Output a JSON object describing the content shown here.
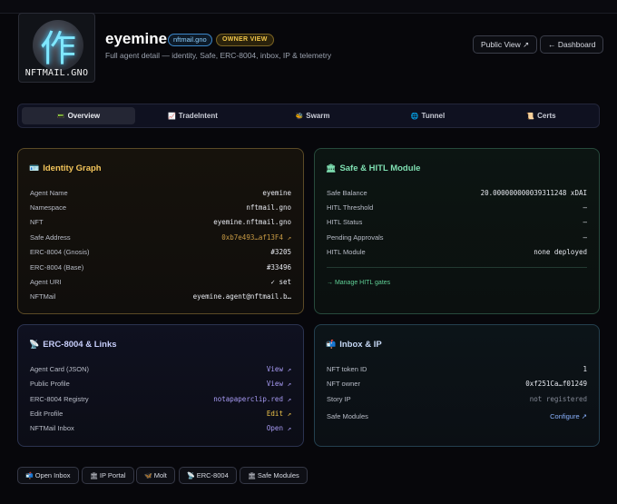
{
  "agent": {
    "avatar_glyph": "作",
    "avatar_caption": "NFTMAIL.GNO",
    "name": "eyemine",
    "namespace_badge": "nftmail.gno",
    "owner_badge": "OWNER VIEW",
    "subtitle": "Full agent detail — identity, Safe, ERC-8004, inbox, IP & telemetry"
  },
  "header_buttons": {
    "public_view": "Public View ↗",
    "dashboard": "← Dashboard"
  },
  "tabs": [
    {
      "icon": "📟",
      "label": "Overview",
      "active": true
    },
    {
      "icon": "📈",
      "label": "TradeIntent"
    },
    {
      "icon": "🐝",
      "label": "Swarm"
    },
    {
      "icon": "🌐",
      "label": "Tunnel"
    },
    {
      "icon": "📜",
      "label": "Certs"
    }
  ],
  "identity": {
    "icon": "🪪",
    "title": "Identity Graph",
    "rows": [
      {
        "label": "Agent Name",
        "value": "eyemine"
      },
      {
        "label": "Namespace",
        "value": "nftmail.gno"
      },
      {
        "label": "NFT",
        "value": "eyemine.nftmail.gno"
      },
      {
        "label": "Safe Address",
        "value": "0xb7e493…af13F4 ↗"
      },
      {
        "label": "ERC-8004 (Gnosis)",
        "value": "#3205"
      },
      {
        "label": "ERC-8004 (Base)",
        "value": "#33496"
      },
      {
        "label": "Agent URI",
        "value": "✓ set"
      },
      {
        "label": "NFTMail",
        "value": "eyemine.agent@nftmail.b…"
      }
    ]
  },
  "safe": {
    "icon": "🏛",
    "title": "Safe & HITL Module",
    "rows": [
      {
        "label": "Safe Balance",
        "value": "20.000000000039311248 xDAI"
      },
      {
        "label": "HITL Threshold",
        "value": "—"
      },
      {
        "label": "HITL Status",
        "value": "—"
      },
      {
        "label": "Pending Approvals",
        "value": "—"
      },
      {
        "label": "HITL Module",
        "value": "none deployed"
      }
    ],
    "manage_link": "→ Manage HITL gates"
  },
  "erc": {
    "icon": "📡",
    "title": "ERC-8004 & Links",
    "rows": [
      {
        "label": "Agent Card (JSON)",
        "value": "View ↗"
      },
      {
        "label": "Public Profile",
        "value": "View ↗"
      },
      {
        "label": "ERC-8004 Registry",
        "value": "notapaperclip.red ↗"
      },
      {
        "label": "Edit Profile",
        "value": "Edit ↗"
      },
      {
        "label": "NFTMail Inbox",
        "value": "Open ↗"
      }
    ]
  },
  "inbox": {
    "icon": "📬",
    "title": "Inbox & IP",
    "rows": [
      {
        "label": "NFT token ID",
        "value": "1"
      },
      {
        "label": "NFT owner",
        "value": "0xf251Ca…f01249"
      },
      {
        "label": "Story IP",
        "value": "not registered"
      },
      {
        "label": "Safe Modules",
        "value": "Configure ↗"
      }
    ]
  },
  "bottom_buttons": [
    {
      "icon": "📬",
      "label": "Open Inbox"
    },
    {
      "icon": "🏛",
      "label": "IP Portal"
    },
    {
      "icon": "🦋",
      "label": "Molt"
    },
    {
      "icon": "📡",
      "label": "ERC-8004"
    },
    {
      "icon": "🏛",
      "label": "Safe Modules"
    }
  ],
  "colors": {
    "background": "#07070b",
    "gold_accent": "#f2c45a",
    "green_accent": "#7fe0b2",
    "link_purple": "#a99cf6",
    "link_blue": "#8ab2ff"
  }
}
